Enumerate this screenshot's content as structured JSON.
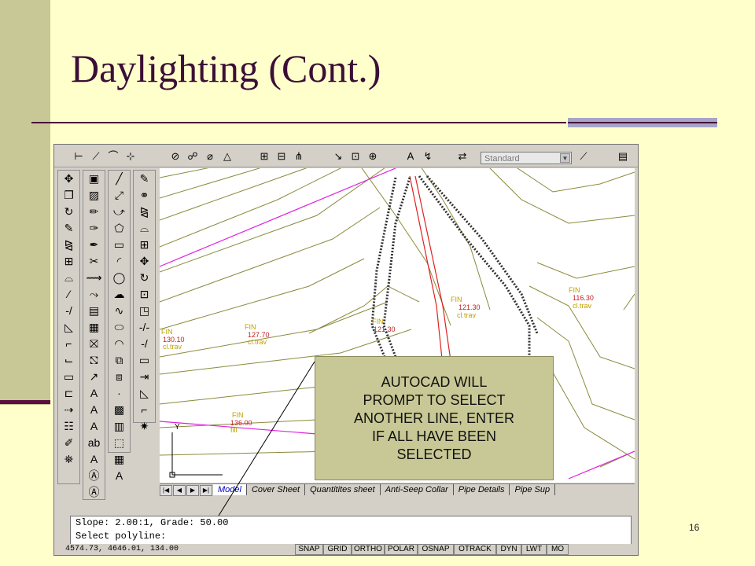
{
  "slide": {
    "title": "Daylighting (Cont.)",
    "page_number": "16",
    "colors": {
      "background": "#ffffcc",
      "accent_bar": "#c8c896",
      "title": "#3b0f36"
    }
  },
  "autocad": {
    "style_dropdown": {
      "value": "Standard"
    },
    "drawing": {
      "labels": [
        {
          "code": "FIN",
          "value": "121.30",
          "type": "cl.trav"
        },
        {
          "code": "FIN",
          "value": "116.30",
          "type": "cl.trav"
        },
        {
          "code": "FIN",
          "value": "127.70",
          "type": "cl.trav"
        },
        {
          "code": "FIN",
          "value": "130.10",
          "type": "cl.trav"
        },
        {
          "code": "FIN",
          "value": "136.00",
          "type": "fill"
        },
        {
          "code": "FIN",
          "value": "121.30",
          "type": ""
        }
      ],
      "axis_label": "Y"
    },
    "tabs": [
      "Model",
      "Cover Sheet",
      "Quantitites sheet",
      "Anti-Seep Collar",
      "Pipe Details",
      "Pipe Sup"
    ],
    "command_lines": [
      "Slope: 2.00:1, Grade: 50.00",
      "Select polyline:"
    ],
    "status_bar": {
      "coordinates": "4574.73, 4646.01, 134.00",
      "buttons": [
        "SNAP",
        "GRID",
        "ORTHO",
        "POLAR",
        "OSNAP",
        "OTRACK",
        "DYN",
        "LWT",
        "MO"
      ]
    }
  },
  "callout": {
    "text": "AUTOCAD WILL\nPROMPT TO SELECT\nANOTHER LINE, ENTER\nIF ALL HAVE BEEN\nSELECTED"
  }
}
